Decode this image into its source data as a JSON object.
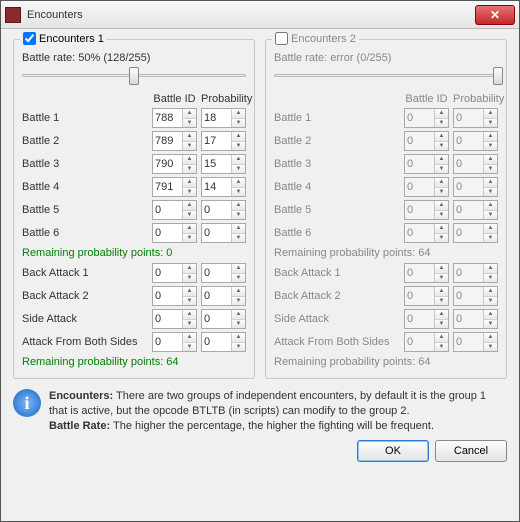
{
  "window": {
    "title": "Encounters"
  },
  "groups": [
    {
      "id": 1,
      "checked": true,
      "title": "Encounters 1",
      "rate": "Battle rate: 50% (128/255)",
      "thumb_pct": 50,
      "hdr_id": "Battle ID",
      "hdr_prob": "Probability",
      "battles": [
        {
          "label": "Battle 1",
          "id": "788",
          "prob": "18"
        },
        {
          "label": "Battle 2",
          "id": "789",
          "prob": "17"
        },
        {
          "label": "Battle 3",
          "id": "790",
          "prob": "15"
        },
        {
          "label": "Battle 4",
          "id": "791",
          "prob": "14"
        },
        {
          "label": "Battle 5",
          "id": "0",
          "prob": "0"
        },
        {
          "label": "Battle 6",
          "id": "0",
          "prob": "0"
        }
      ],
      "remain1": "Remaining probability points: 0",
      "special": [
        {
          "label": "Back Attack 1",
          "id": "0",
          "prob": "0"
        },
        {
          "label": "Back Attack 2",
          "id": "0",
          "prob": "0"
        },
        {
          "label": "Side Attack",
          "id": "0",
          "prob": "0"
        },
        {
          "label": "Attack From Both Sides",
          "id": "0",
          "prob": "0"
        }
      ],
      "remain2": "Remaining probability points: 64"
    },
    {
      "id": 2,
      "checked": false,
      "title": "Encounters 2",
      "rate": "Battle rate: error (0/255)",
      "thumb_pct": 100,
      "hdr_id": "Battle ID",
      "hdr_prob": "Probability",
      "battles": [
        {
          "label": "Battle 1",
          "id": "0",
          "prob": "0"
        },
        {
          "label": "Battle 2",
          "id": "0",
          "prob": "0"
        },
        {
          "label": "Battle 3",
          "id": "0",
          "prob": "0"
        },
        {
          "label": "Battle 4",
          "id": "0",
          "prob": "0"
        },
        {
          "label": "Battle 5",
          "id": "0",
          "prob": "0"
        },
        {
          "label": "Battle 6",
          "id": "0",
          "prob": "0"
        }
      ],
      "remain1": "Remaining probability points: 64",
      "special": [
        {
          "label": "Back Attack 1",
          "id": "0",
          "prob": "0"
        },
        {
          "label": "Back Attack 2",
          "id": "0",
          "prob": "0"
        },
        {
          "label": "Side Attack",
          "id": "0",
          "prob": "0"
        },
        {
          "label": "Attack From Both Sides",
          "id": "0",
          "prob": "0"
        }
      ],
      "remain2": "Remaining probability points: 64"
    }
  ],
  "info": {
    "line1_b": "Encounters:",
    "line1": " There are two groups of independent encounters, by default it is the group 1 that is active, but the opcode BTLTB (in scripts) can modify to the group 2.",
    "line2_b": "Battle Rate:",
    "line2": " The higher the percentage, the higher the fighting will be frequent."
  },
  "buttons": {
    "ok": "OK",
    "cancel": "Cancel"
  }
}
